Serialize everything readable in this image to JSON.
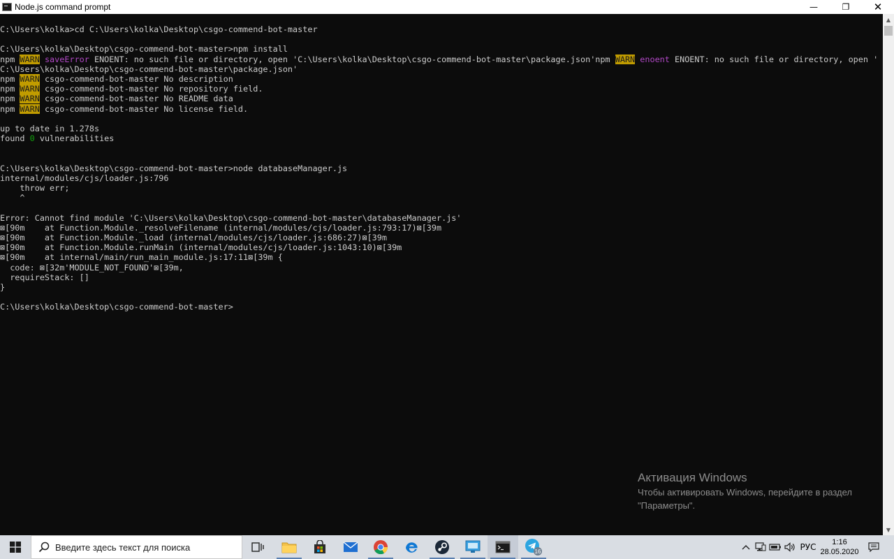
{
  "window": {
    "title": "Node.js command prompt",
    "minimize": "—",
    "maximize": "❐",
    "close": "✕"
  },
  "console": {
    "lines": [
      [
        {
          "t": "C:\\Users\\kolka>cd C:\\Users\\kolka\\Desktop\\csgo-commend-bot-master"
        }
      ],
      [],
      [
        {
          "t": "C:\\Users\\kolka\\Desktop\\csgo-commend-bot-master>npm install"
        }
      ],
      [
        {
          "t": "npm "
        },
        {
          "t": "WARN",
          "c": "warn"
        },
        {
          "t": " "
        },
        {
          "t": "saveError",
          "c": "magenta"
        },
        {
          "t": " ENOENT: no such file or directory, open 'C:\\Users\\kolka\\Desktop\\csgo-commend-bot-master\\package.json'npm "
        },
        {
          "t": "WARN",
          "c": "warn"
        },
        {
          "t": " "
        },
        {
          "t": "enoent",
          "c": "magenta"
        },
        {
          "t": " ENOENT: no such file or directory, open '"
        }
      ],
      [
        {
          "t": "C:\\Users\\kolka\\Desktop\\csgo-commend-bot-master\\package.json'"
        }
      ],
      [
        {
          "t": "npm "
        },
        {
          "t": "WARN",
          "c": "warn"
        },
        {
          "t": " csgo-commend-bot-master No description"
        }
      ],
      [
        {
          "t": "npm "
        },
        {
          "t": "WARN",
          "c": "warn"
        },
        {
          "t": " csgo-commend-bot-master No repository field."
        }
      ],
      [
        {
          "t": "npm "
        },
        {
          "t": "WARN",
          "c": "warn"
        },
        {
          "t": " csgo-commend-bot-master No README data"
        }
      ],
      [
        {
          "t": "npm "
        },
        {
          "t": "WARN",
          "c": "warn"
        },
        {
          "t": " csgo-commend-bot-master No license field."
        }
      ],
      [],
      [
        {
          "t": "up to date in 1.278s"
        }
      ],
      [
        {
          "t": "found "
        },
        {
          "t": "0",
          "c": "green"
        },
        {
          "t": " vulnerabilities"
        }
      ],
      [],
      [],
      [
        {
          "t": "C:\\Users\\kolka\\Desktop\\csgo-commend-bot-master>node databaseManager.js"
        }
      ],
      [
        {
          "t": "internal/modules/cjs/loader.js:796"
        }
      ],
      [
        {
          "t": "    throw err;"
        }
      ],
      [
        {
          "t": "    ^"
        }
      ],
      [],
      [
        {
          "t": "Error: Cannot find module 'C:\\Users\\kolka\\Desktop\\csgo-commend-bot-master\\databaseManager.js'"
        }
      ],
      [
        {
          "t": "⊠[90m    at Function.Module._resolveFilename (internal/modules/cjs/loader.js:793:17)⊠[39m"
        }
      ],
      [
        {
          "t": "⊠[90m    at Function.Module._load (internal/modules/cjs/loader.js:686:27)⊠[39m"
        }
      ],
      [
        {
          "t": "⊠[90m    at Function.Module.runMain (internal/modules/cjs/loader.js:1043:10)⊠[39m"
        }
      ],
      [
        {
          "t": "⊠[90m    at internal/main/run_main_module.js:17:11⊠[39m {"
        }
      ],
      [
        {
          "t": "  code: ⊠[32m'MODULE_NOT_FOUND'⊠[39m,"
        }
      ],
      [
        {
          "t": "  requireStack: []"
        }
      ],
      [
        {
          "t": "}"
        }
      ],
      [],
      [
        {
          "t": "C:\\Users\\kolka\\Desktop\\csgo-commend-bot-master>"
        }
      ]
    ]
  },
  "watermark": {
    "title": "Активация Windows",
    "line1": "Чтобы активировать Windows, перейдите в раздел",
    "line2": "\"Параметры\"."
  },
  "taskbar": {
    "search_placeholder": "Введите здесь текст для поиска",
    "language": "РУС",
    "time": "1:16",
    "date": "28.05.2020",
    "telegram_badge": "16"
  },
  "colors": {
    "console_bg": "#0c0c0c",
    "console_text": "#cccccc",
    "warn_bg": "#c19c00",
    "magenta": "#b148c6",
    "green": "#13a10e",
    "taskbar_bg": "#d9dde3"
  }
}
